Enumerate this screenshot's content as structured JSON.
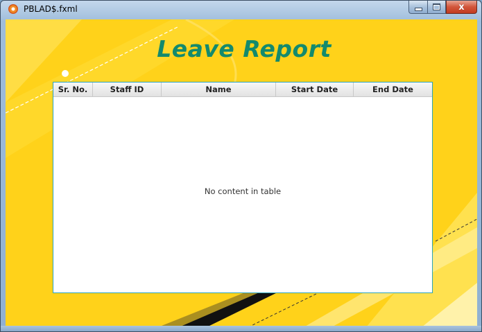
{
  "window": {
    "title": "PBLAD$.fxml",
    "close_glyph": "x"
  },
  "heading": "Leave Report",
  "table": {
    "columns": [
      "Sr. No.",
      "Staff ID",
      "Name",
      "Start Date",
      "End Date"
    ],
    "rows": [],
    "empty_message": "No content in table"
  },
  "colors": {
    "background_yellow": "#ffd21a",
    "heading_green": "#138a6d",
    "table_border": "#2aa3b8"
  },
  "icons": {
    "app": "app-logo-icon",
    "minimize": "minimize-icon",
    "maximize": "maximize-icon",
    "close": "close-icon"
  }
}
